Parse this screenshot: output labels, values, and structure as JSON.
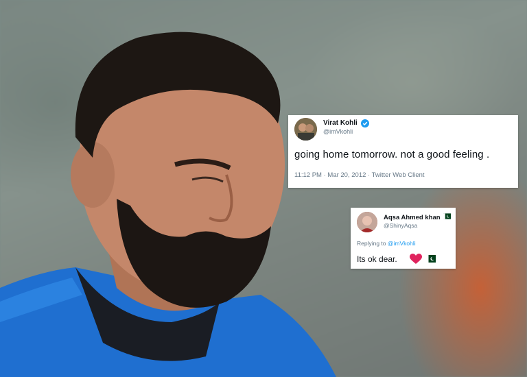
{
  "tweet": {
    "author_name": "Virat Kohli",
    "author_handle": "@imVkohli",
    "text": "going home tomorrow. not a good feeling .",
    "meta": "11:12 PM · Mar 20, 2012 · Twitter Web Client",
    "verified_icon": "verified-badge-icon"
  },
  "reply": {
    "author_name": "Aqsa Ahmed khan",
    "author_handle": "@ShinyAqsa",
    "replying_prefix": "Replying to",
    "replying_to": "@imVkohli",
    "text": "Its ok dear.",
    "emojis": [
      "red-heart-icon",
      "pakistan-flag-icon"
    ]
  },
  "colors": {
    "link": "#1d9bf0",
    "secondary_text": "#657786",
    "heart": "#e0245e",
    "flag_green": "#01411c"
  }
}
